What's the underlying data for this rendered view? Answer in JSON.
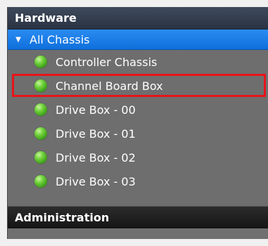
{
  "nav": {
    "hardware_label": "Hardware",
    "root": {
      "label": "All Chassis",
      "toggle_glyph": "▼"
    },
    "items": [
      {
        "label": "Controller Chassis",
        "status": "ok"
      },
      {
        "label": "Channel Board Box",
        "status": "ok",
        "selected": true
      },
      {
        "label": "Drive Box - 00",
        "status": "ok"
      },
      {
        "label": "Drive Box - 01",
        "status": "ok"
      },
      {
        "label": "Drive Box - 02",
        "status": "ok"
      },
      {
        "label": "Drive Box - 03",
        "status": "ok"
      }
    ],
    "administration_label": "Administration"
  },
  "colors": {
    "selected_root": "#1a7ee8",
    "status_ok": "#5cc22a",
    "highlight_outline": "#e8141a",
    "panel_bg": "#6e6e6e"
  }
}
